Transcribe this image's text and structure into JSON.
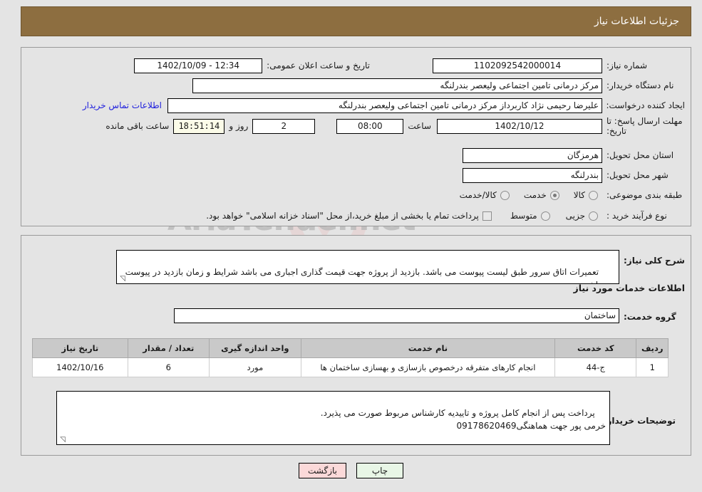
{
  "header": {
    "title": "جزئیات اطلاعات نیاز"
  },
  "watermark": {
    "text": "AriaTender.net"
  },
  "top_panel": {
    "need_number": {
      "label": "شماره نیاز:",
      "value": "1102092542000014"
    },
    "announce_datetime": {
      "label": "تاریخ و ساعت اعلان عمومی:",
      "value": "1402/10/09 - 12:34"
    },
    "buyer_org": {
      "label": "نام دستگاه خریدار:",
      "value": "مرکز درمانی تامین اجتماعی ولیعصر بندرلنگه"
    },
    "requester": {
      "label": "ایجاد کننده درخواست:",
      "value": "علیرضا رحیمی نژاد کاربرداز مرکز درمانی تامین اجتماعی ولیعصر بندرلنگه",
      "contact_link": "اطلاعات تماس خریدار"
    },
    "deadline": {
      "label": "مهلت ارسال پاسخ: تا تاریخ:",
      "date": "1402/10/12",
      "time_label": "ساعت",
      "time": "08:00",
      "days": "2",
      "days_label": "روز و",
      "countdown": "18:51:14",
      "countdown_label": "ساعت باقی مانده"
    },
    "delivery_province": {
      "label": "استان محل تحویل:",
      "value": "هرمزگان"
    },
    "delivery_city": {
      "label": "شهر محل تحویل:",
      "value": "بندرلنگه"
    },
    "subject_category": {
      "label": "طبقه بندی موضوعی:",
      "options": [
        {
          "text": "کالا",
          "selected": false
        },
        {
          "text": "خدمت",
          "selected": true
        },
        {
          "text": "کالا/خدمت",
          "selected": false
        }
      ]
    },
    "purchase_process": {
      "label": "نوع فرآیند خرید :",
      "options": [
        {
          "text": "جزیی",
          "selected": false
        },
        {
          "text": "متوسط",
          "selected": false
        }
      ],
      "checkbox_note": "پرداخت تمام یا بخشی از مبلغ خرید،از محل \"اسناد خزانه اسلامی\" خواهد بود.",
      "checkbox_checked": false
    }
  },
  "mid_panel": {
    "general_description": {
      "label": "شرح کلی نیاز:",
      "value": "تعمیرات اتاق سرور طبق لیست پیوست می باشد. بازدید از پروژه جهت قیمت گذاری اجباری می باشد شرایط و زمان بازدید در پیوست می باشد."
    },
    "services_section_title": "اطلاعات خدمات مورد نیاز",
    "service_group": {
      "label": "گروه خدمت:",
      "value": "ساختمان"
    },
    "table": {
      "columns": [
        "ردیف",
        "کد خدمت",
        "نام خدمت",
        "واحد اندازه گیری",
        "تعداد / مقدار",
        "تاریخ نیاز"
      ],
      "rows": [
        {
          "row_no": "1",
          "service_code": "ج-44",
          "service_name": "انجام کارهای متفرقه درخصوص بازسازی و بهسازی ساختمان ها",
          "unit": "مورد",
          "quantity": "6",
          "need_date": "1402/10/16"
        }
      ]
    },
    "buyer_notes": {
      "label": "توضیحات خریدار:",
      "value": "پرداخت پس از انجام کامل پروژه و تاییدیه کارشناس مربوط صورت می پذیرد.\nخرمی پور جهت هماهنگی09178620469"
    }
  },
  "footer": {
    "print_label": "چاپ",
    "back_label": "بازگشت"
  },
  "colors": {
    "header_bg": "#8d6e40",
    "link": "#2020dd",
    "back_btn": "#fbd9d9",
    "print_btn": "#e8f6e6",
    "table_header": "#c9c9c9",
    "timer_bg": "#fbfbe8"
  }
}
